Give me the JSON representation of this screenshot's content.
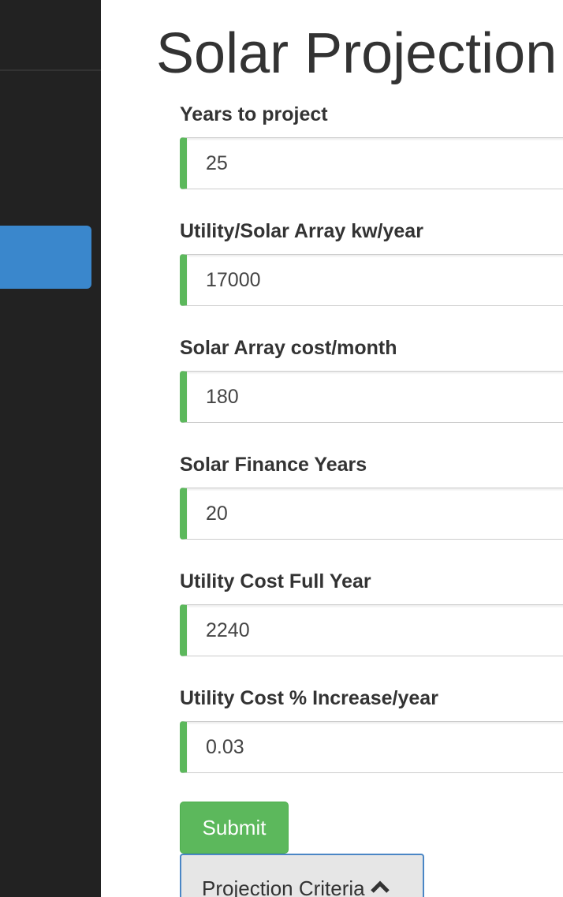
{
  "page": {
    "title": "Solar Projection"
  },
  "sidebar": {
    "active_color": "#3a87cc"
  },
  "form": {
    "fields": [
      {
        "label": "Years to project",
        "value": "25"
      },
      {
        "label": "Utility/Solar Array kw/year",
        "value": "17000"
      },
      {
        "label": "Solar Array cost/month",
        "value": "180"
      },
      {
        "label": "Solar Finance Years",
        "value": "20"
      },
      {
        "label": "Utility Cost Full Year",
        "value": "2240"
      },
      {
        "label": "Utility Cost % Increase/year",
        "value": "0.03"
      }
    ],
    "submit_label": "Submit"
  },
  "criteria_toggle": {
    "label": "Projection Criteria",
    "icon": "chevron-up-icon"
  },
  "colors": {
    "sidebar_bg": "#222222",
    "success_green": "#5cb85c",
    "focus_blue": "#4a86c5"
  }
}
